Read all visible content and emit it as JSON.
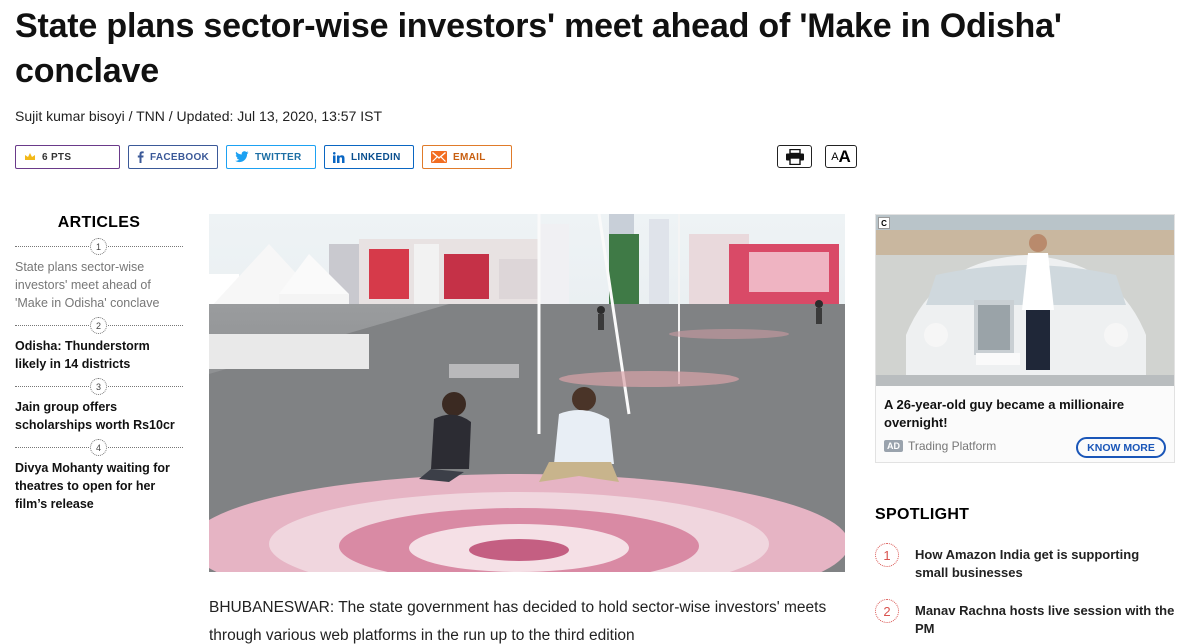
{
  "headline": "State plans sector-wise investors' meet ahead of 'Make in Odisha' conclave",
  "byline": "Sujit kumar bisoyi / TNN / Updated: Jul 13, 2020, 13:57 IST",
  "share": {
    "points": "6 PTS",
    "facebook": "FACEBOOK",
    "twitter": "TWITTER",
    "linkedin": "LINKEDIN",
    "email": "EMAIL"
  },
  "tools": {
    "font_small": "A",
    "font_big": "A"
  },
  "articles": {
    "title": "ARTICLES",
    "items": [
      {
        "num": "1",
        "text": "State plans sector-wise investors' meet ahead of 'Make in Odisha' conclave"
      },
      {
        "num": "2",
        "text": "Odisha: Thunderstorm likely in 14 districts"
      },
      {
        "num": "3",
        "text": "Jain group offers scholarships worth Rs10cr"
      },
      {
        "num": "4",
        "text": "Divya Mohanty waiting for theatres to open for her film’s release"
      }
    ]
  },
  "body": "BHUBANESWAR: The state government has decided to hold sector-wise investors' meets through various web platforms in the run up to the third edition",
  "ad": {
    "corner": "C",
    "title": "A 26-year-old guy became a millionaire overnight!",
    "badge": "AD",
    "sponsor": "Trading Platform",
    "cta": "KNOW MORE"
  },
  "spotlight": {
    "title": "SPOTLIGHT",
    "items": [
      {
        "num": "1",
        "text": "How Amazon India get is supporting small businesses"
      },
      {
        "num": "2",
        "text": "Manav Rachna hosts live session with the PM"
      }
    ]
  },
  "colors": {
    "spot_red": "#d9534f",
    "cta_blue": "#1a56b8"
  }
}
